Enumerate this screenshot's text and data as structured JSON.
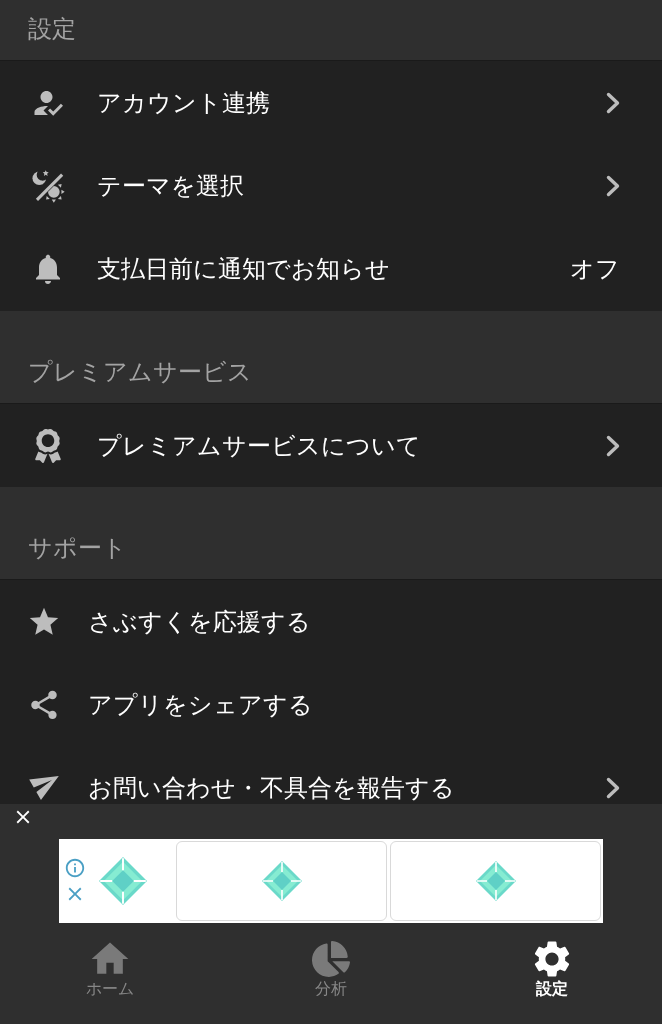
{
  "sections": [
    {
      "title": "設定",
      "items": [
        {
          "kind": "link",
          "label": "アカウント連携"
        },
        {
          "kind": "link",
          "label": "テーマを選択"
        },
        {
          "kind": "value",
          "label": "支払日前に通知でお知らせ",
          "value": "オフ"
        }
      ]
    },
    {
      "title": "プレミアムサービス",
      "items": [
        {
          "kind": "link",
          "label": "プレミアムサービスについて"
        }
      ]
    },
    {
      "title": "サポート",
      "items": [
        {
          "kind": "action",
          "label": "さぶすくを応援する"
        },
        {
          "kind": "action",
          "label": "アプリをシェアする"
        },
        {
          "kind": "link",
          "label": "お問い合わせ・不具合を報告する"
        }
      ]
    }
  ],
  "tab_bar": [
    {
      "label": "ホーム",
      "selected": false
    },
    {
      "label": "分析",
      "selected": false
    },
    {
      "label": "設定",
      "selected": true
    }
  ]
}
